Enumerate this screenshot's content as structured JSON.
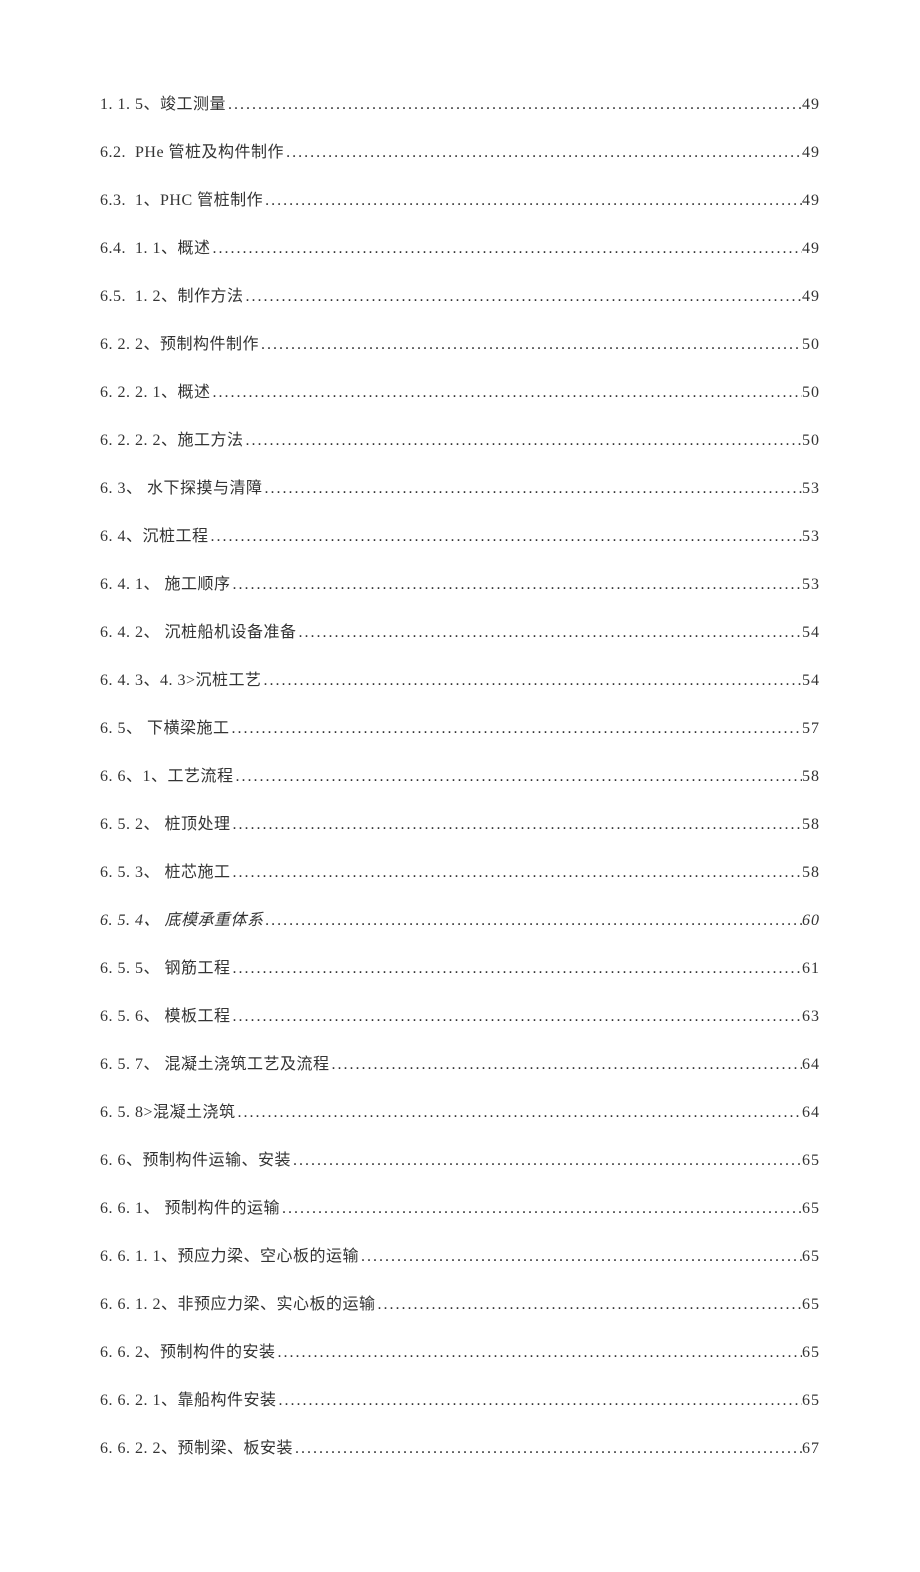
{
  "toc": [
    {
      "label": "1. 1. 5、竣工测量",
      "page": "49",
      "italic": false
    },
    {
      "label": "6.2.  PHe 管桩及构件制作 ",
      "page": "49",
      "italic": false
    },
    {
      "label": "6.3.  1、PHC 管桩制作",
      "page": "49",
      "italic": false
    },
    {
      "label": "6.4.  1. 1、概述 ",
      "page": "49",
      "italic": false
    },
    {
      "label": "6.5.  1. 2、制作方法 ",
      "page": "49",
      "italic": false
    },
    {
      "label": "6. 2. 2、预制构件制作 ",
      "page": "50",
      "italic": false
    },
    {
      "label": "6. 2. 2. 1、概述 ",
      "page": "50",
      "italic": false
    },
    {
      "label": "6. 2. 2. 2、施工方法 ",
      "page": "50",
      "italic": false
    },
    {
      "label": "6. 3、 水下探摸与清障",
      "page": "53",
      "italic": false
    },
    {
      "label": "6. 4、沉桩工程",
      "page": "53",
      "italic": false
    },
    {
      "label": "6. 4. 1、 施工顺序 ",
      "page": "53",
      "italic": false
    },
    {
      "label": "6. 4. 2、 沉桩船机设备准备 ",
      "page": "54",
      "italic": false
    },
    {
      "label": "6. 4. 3、4. 3>沉桩工艺 ",
      "page": "54",
      "italic": false
    },
    {
      "label": "6. 5、 下横梁施工",
      "page": "57",
      "italic": false
    },
    {
      "label": "6. 6、1、工艺流程 ",
      "page": "58",
      "italic": false
    },
    {
      "label": "6. 5. 2、 桩顶处理 ",
      "page": "58",
      "italic": false
    },
    {
      "label": "6. 5. 3、 桩芯施工 ",
      "page": "58",
      "italic": false
    },
    {
      "label": "6. 5. 4、 底模承重体系",
      "page": "60",
      "italic": true
    },
    {
      "label": "6. 5. 5、 钢筋工程 ",
      "page": "61",
      "italic": false
    },
    {
      "label": "6. 5. 6、 模板工程 ",
      "page": "63",
      "italic": false
    },
    {
      "label": "6. 5. 7、 混凝土浇筑工艺及流程",
      "page": "64",
      "italic": false
    },
    {
      "label": "6. 5. 8>混凝土浇筑 ",
      "page": "64",
      "italic": false
    },
    {
      "label": "6. 6、预制构件运输、安装",
      "page": "65",
      "italic": false
    },
    {
      "label": "6. 6. 1、 预制构件的运输 ",
      "page": "65",
      "italic": false
    },
    {
      "label": "6. 6. 1. 1、预应力梁、空心板的运输 ",
      "page": "65",
      "italic": false
    },
    {
      "label": "6. 6. 1. 2、非预应力梁、实心板的运输 ",
      "page": "65",
      "italic": false
    },
    {
      "label": "6. 6. 2、预制构件的安装 ",
      "page": "65",
      "italic": false
    },
    {
      "label": "6. 6. 2. 1、靠船构件安装 ",
      "page": "65",
      "italic": false
    },
    {
      "label": "6. 6. 2. 2、预制梁、板安装 ",
      "page": "67",
      "italic": false
    }
  ]
}
